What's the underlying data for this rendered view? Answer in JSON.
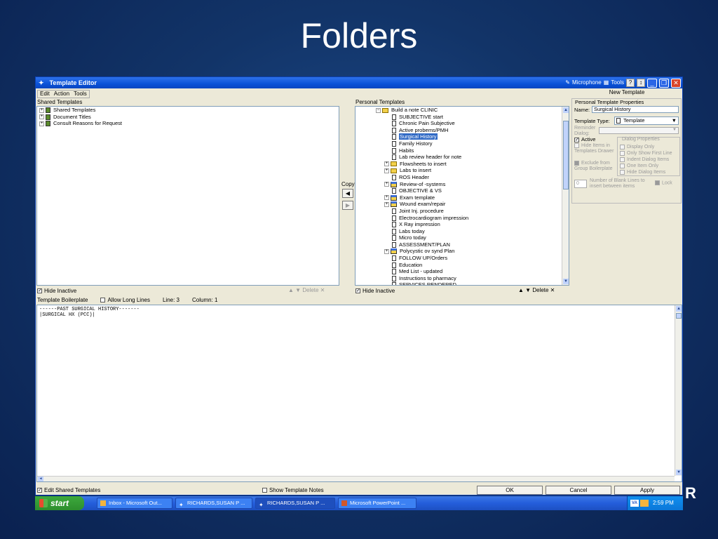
{
  "slide": {
    "title": "Folders"
  },
  "window": {
    "title": "Template Editor",
    "toolbar_right": {
      "microphone": "Microphone",
      "tools": "Tools"
    },
    "menu": [
      "Edit",
      "Action",
      "Tools"
    ]
  },
  "shared": {
    "label": "Shared Templates",
    "items": [
      "Shared Templates",
      "Document Titles",
      "Consult Reasons for Request"
    ],
    "hide_inactive": "Hide Inactive",
    "delete_label": "Delete"
  },
  "copy_label": "Copy",
  "personal": {
    "label": "Personal Templates",
    "root": "Build a note CLINIC",
    "items": [
      {
        "label": "SUBJECTIVE start",
        "icon": "doc"
      },
      {
        "label": "Chronic Pain Subjective",
        "icon": "doc"
      },
      {
        "label": "Active probems/PMH",
        "icon": "doc"
      },
      {
        "label": "Surgical History",
        "icon": "doc",
        "selected": true
      },
      {
        "label": "Family History",
        "icon": "doc"
      },
      {
        "label": "Habits",
        "icon": "doc"
      },
      {
        "label": "Lab review header for note",
        "icon": "doc"
      },
      {
        "label": "Flowsheets to insert",
        "icon": "folder",
        "expand": true
      },
      {
        "label": "Labs to insert",
        "icon": "folder",
        "expand": true
      },
      {
        "label": "ROS Header",
        "icon": "doc"
      },
      {
        "label": "Review-of -systems",
        "icon": "group",
        "expand": true
      },
      {
        "label": "OBJECTIVE & VS",
        "icon": "doc"
      },
      {
        "label": "Exam template",
        "icon": "group",
        "expand": true
      },
      {
        "label": "Wound exam/repair",
        "icon": "group",
        "expand": true
      },
      {
        "label": "Joint Inj. procedure",
        "icon": "doc"
      },
      {
        "label": "Electrocardiogram impression",
        "icon": "doc"
      },
      {
        "label": "X Ray impression",
        "icon": "doc"
      },
      {
        "label": "Labs today",
        "icon": "doc"
      },
      {
        "label": "Micro today",
        "icon": "doc"
      },
      {
        "label": "ASSESSMENT/PLAN",
        "icon": "doc"
      },
      {
        "label": "Polycystic ov synd Plan",
        "icon": "group",
        "expand": true
      },
      {
        "label": "FOLLOW UP/Orders",
        "icon": "doc"
      },
      {
        "label": "Education",
        "icon": "doc"
      },
      {
        "label": "Med List - updated",
        "icon": "doc"
      },
      {
        "label": "Instructions to pharmacy",
        "icon": "doc"
      },
      {
        "label": "SERVICES RENDERED",
        "icon": "doc"
      }
    ],
    "hide_inactive": "Hide Inactive",
    "delete_label": "Delete"
  },
  "props": {
    "new_template": "New Template",
    "group_title": "Personal Template Properties",
    "name_label": "Name:",
    "name_value": "Surgical History",
    "type_label": "Template Type:",
    "type_value": "Template",
    "reminder_label": "Reminder Dialog:",
    "active": "Active",
    "hide_items": "Hide Items in Templates Drawer",
    "exclude": "Exclude from Group Boilerplate",
    "dialog_title": "Dialog Properties",
    "dialog_opts": [
      "Display Only",
      "Only Show First Line",
      "Indent Dialog Items",
      "One Item Only",
      "Hide Dialog Items"
    ],
    "blank_lines_value": "0",
    "blank_lines_label": "Number of Blank Lines to insert between items",
    "lock": "Lock"
  },
  "boilerplate": {
    "label": "Template Boilerplate",
    "allow_long": "Allow Long Lines",
    "line": "Line: 3",
    "column": "Column: 1",
    "text_line1": "------PAST SURGICAL HISTORY-------",
    "text_line2": "|SURGICAL HX (PCC)|"
  },
  "bottom": {
    "edit_shared": "Edit Shared Templates",
    "show_notes": "Show Template Notes",
    "ok": "OK",
    "cancel": "Cancel",
    "apply": "Apply"
  },
  "taskbar": {
    "start": "start",
    "tasks": [
      "Inbox - Microsoft Out...",
      "RICHARDS,SUSAN P ...",
      "RICHARDS,SUSAN P ...",
      "Microsoft PowerPoint ..."
    ],
    "tray_va": "VA",
    "clock": "2:59 PM"
  }
}
